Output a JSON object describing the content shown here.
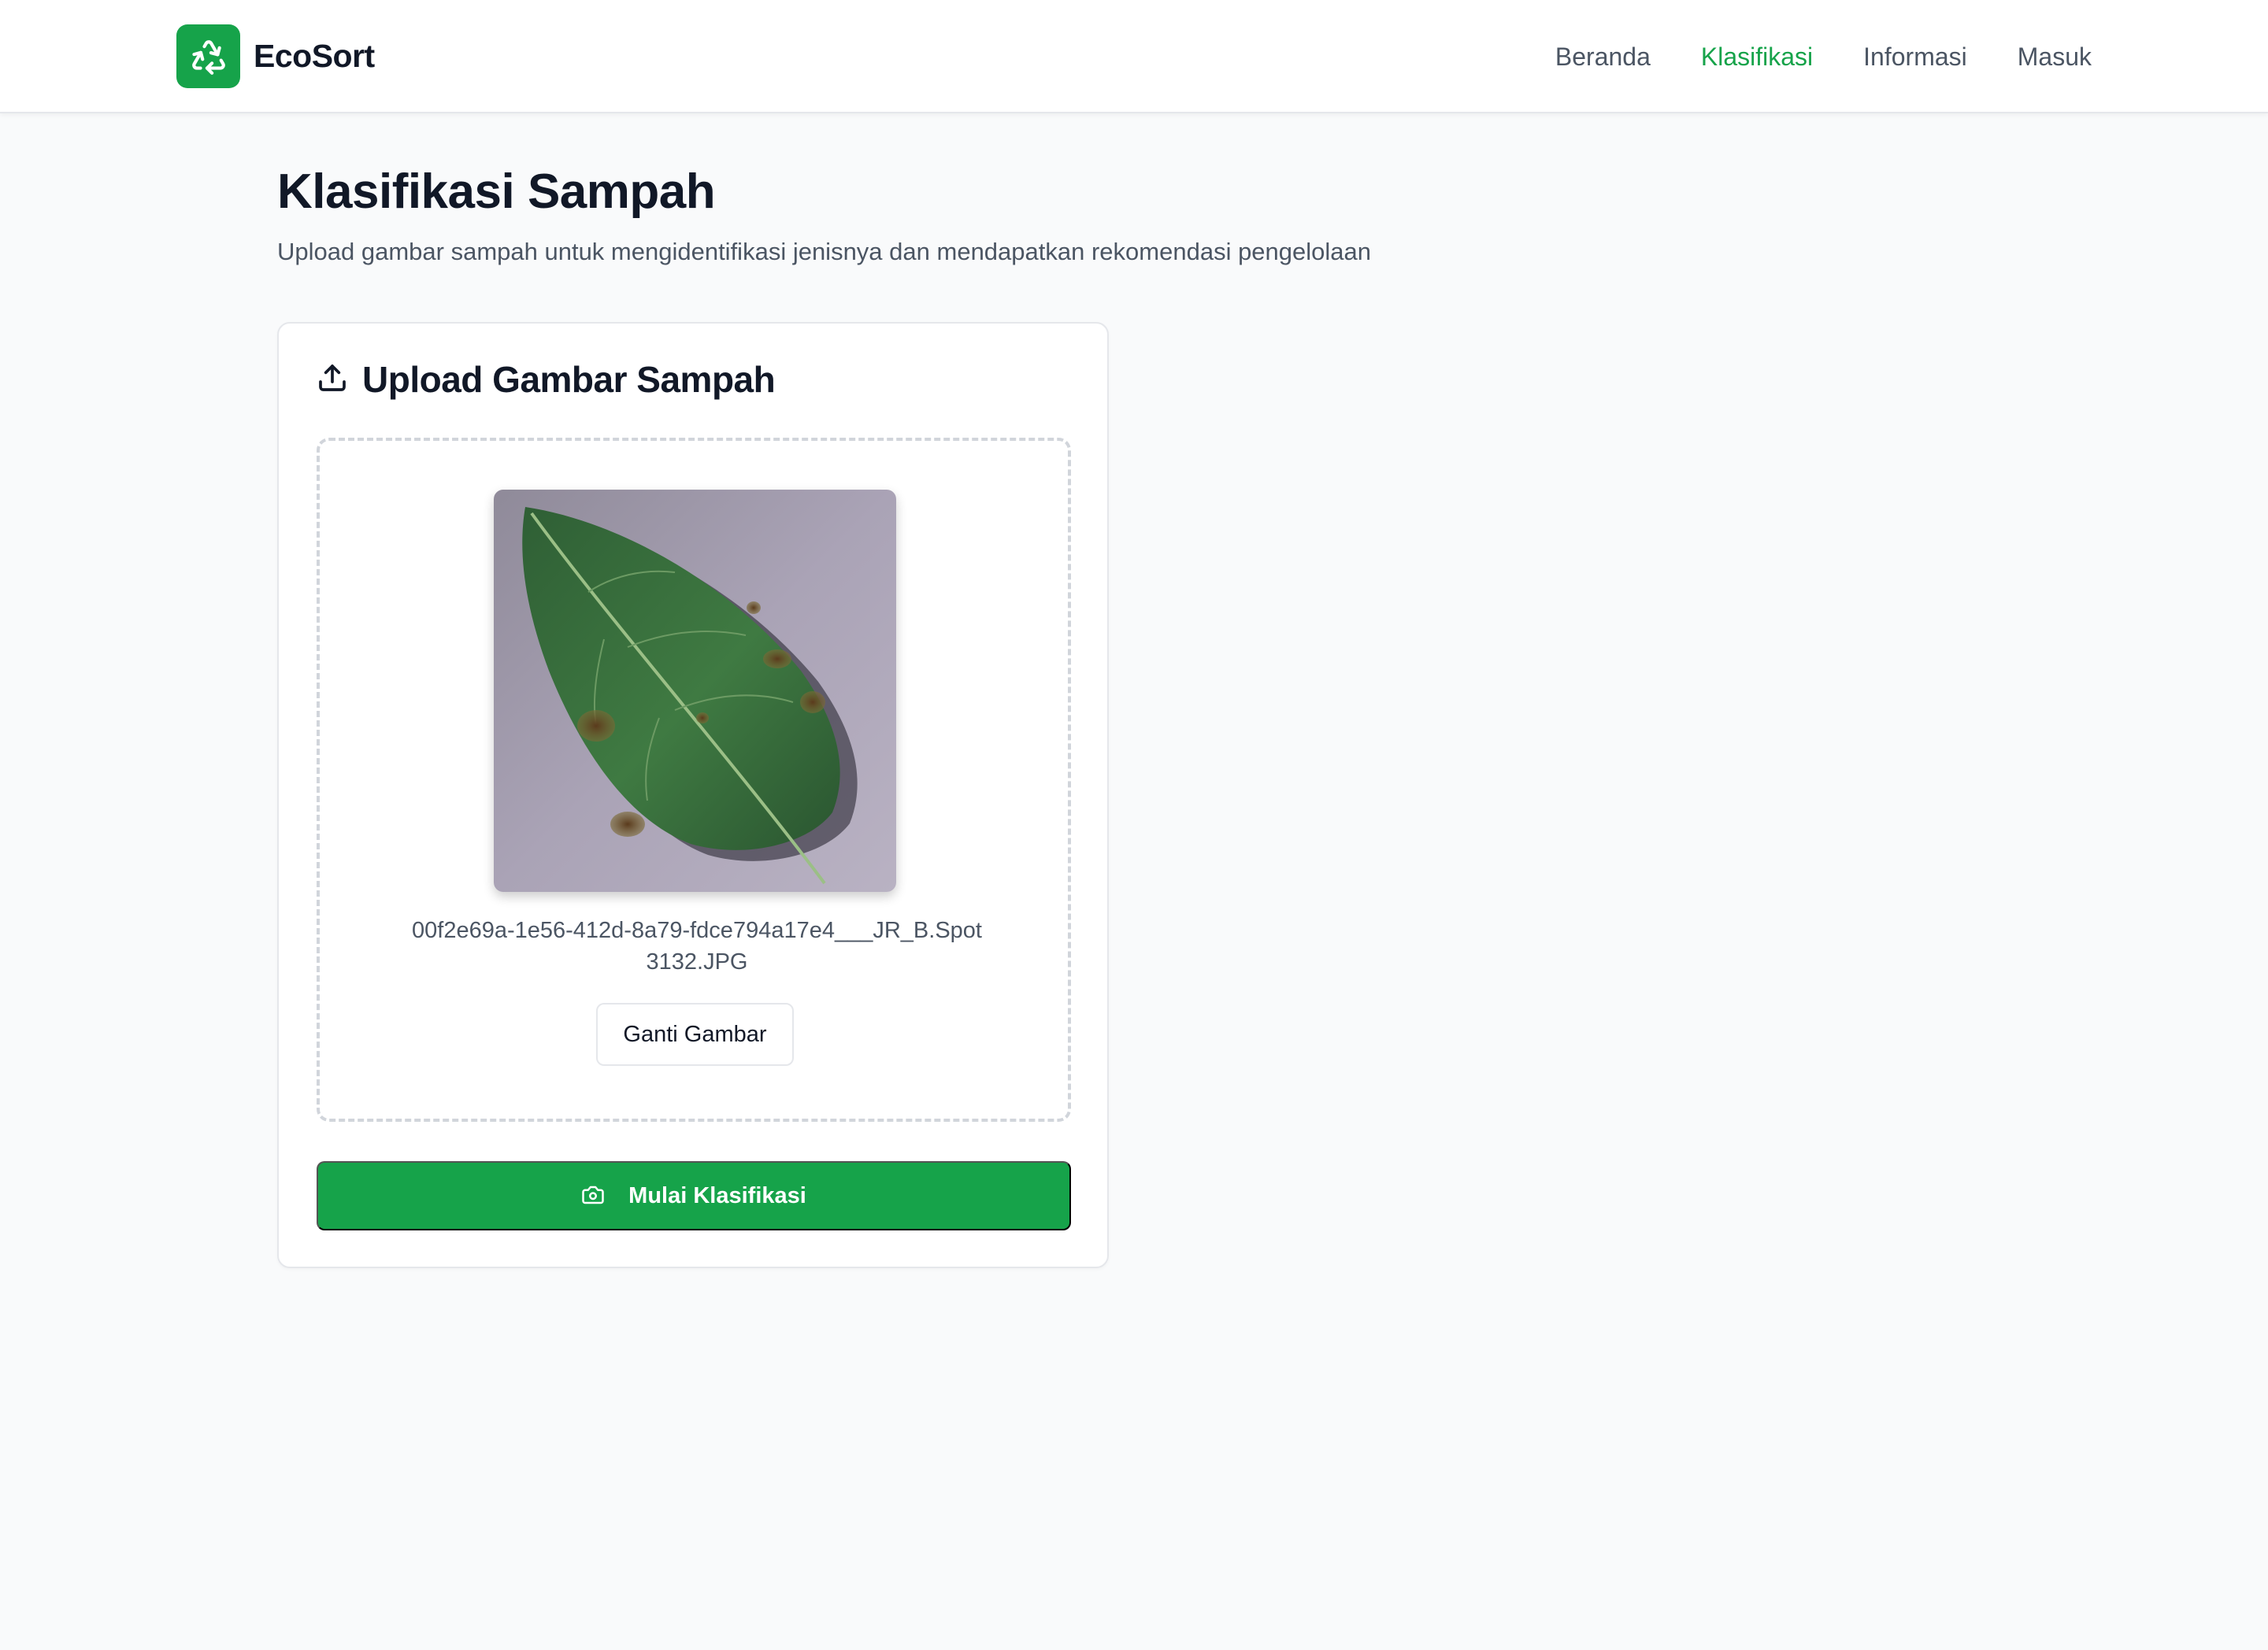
{
  "brand": {
    "name": "EcoSort",
    "logo_icon": "recycle-icon",
    "accent": "#16a34a"
  },
  "nav": {
    "items": [
      {
        "label": "Beranda",
        "active": false
      },
      {
        "label": "Klasifikasi",
        "active": true
      },
      {
        "label": "Informasi",
        "active": false
      },
      {
        "label": "Masuk",
        "active": false
      }
    ]
  },
  "page": {
    "title": "Klasifikasi Sampah",
    "subtitle": "Upload gambar sampah untuk mengidentifikasi jenisnya dan mendapatkan rekomendasi pengelolaan"
  },
  "upload_card": {
    "title": "Upload Gambar Sampah",
    "title_icon": "upload-icon",
    "preview_alt": "leaf photo",
    "filename_line1": "00f2e69a-1e56-412d-8a79-fdce794a17e4___JR_B.Spot",
    "filename_line2": "3132.JPG",
    "change_button": "Ganti Gambar",
    "classify_button": "Mulai Klasifikasi",
    "classify_icon": "camera-icon"
  }
}
